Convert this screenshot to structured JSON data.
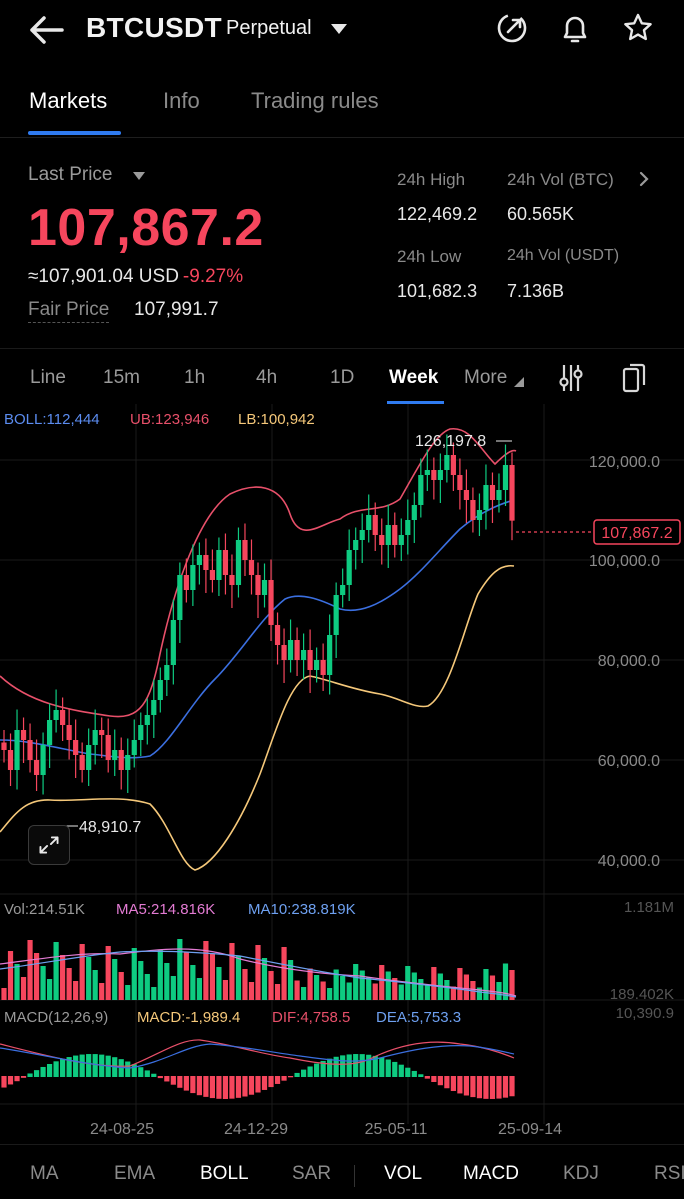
{
  "header": {
    "symbol": "BTCUSDT",
    "contract_type": "Perpetual",
    "icons": [
      "back-arrow-icon",
      "dropdown-caret-icon",
      "share-icon",
      "bell-icon",
      "star-icon"
    ]
  },
  "tabs": [
    {
      "label": "Markets",
      "active": true
    },
    {
      "label": "Info",
      "active": false
    },
    {
      "label": "Trading rules",
      "active": false
    }
  ],
  "price": {
    "last_price_label": "Last Price",
    "last_price": "107,867.2",
    "usd_equiv": "≈107,901.04 USD",
    "change_pct": "-9.27%",
    "fair_price_label": "Fair Price",
    "fair_price": "107,991.7"
  },
  "stats": {
    "high_label": "24h High",
    "high": "122,469.2",
    "low_label": "24h Low",
    "low": "101,682.3",
    "vol_btc_label": "24h Vol (BTC)",
    "vol_btc": "60.565K",
    "vol_usdt_label": "24h Vol  (USDT)",
    "vol_usdt": "7.136B"
  },
  "intervals": [
    "Line",
    "15m",
    "1h",
    "4h",
    "1D",
    "Week",
    "More"
  ],
  "active_interval": "Week",
  "boll_legend": {
    "boll": "BOLL:112,444",
    "ub": "UB:123,946",
    "lb": "LB:100,942"
  },
  "price_axis": {
    "ticks": [
      "120,000.0",
      "100,000.0",
      "80,000.0",
      "60,000.0",
      "40,000.0"
    ],
    "current_tag": "107,867.2",
    "max_label": "126,197.8",
    "min_label": "48,910.7"
  },
  "vol_legend": {
    "vol": "Vol:214.51K",
    "ma5": "MA5:214.816K",
    "ma10": "MA10:238.819K",
    "axis_max": "1.181M",
    "axis_min": "189.402K"
  },
  "macd_legend": {
    "macd_params": "MACD(12,26,9)",
    "macd": "MACD:-1,989.4",
    "dif": "DIF:4,758.5",
    "dea": "DEA:5,753.3",
    "axis_max": "10,390.9"
  },
  "date_axis": [
    "24-08-25",
    "24-12-29",
    "25-05-11",
    "25-09-14"
  ],
  "indicators": [
    {
      "label": "MA",
      "active": false
    },
    {
      "label": "EMA",
      "active": false
    },
    {
      "label": "BOLL",
      "active": true
    },
    {
      "label": "SAR",
      "active": false
    },
    {
      "label": "VOL",
      "active": true
    },
    {
      "label": "MACD",
      "active": true
    },
    {
      "label": "KDJ",
      "active": false
    },
    {
      "label": "RSI",
      "active": false
    }
  ],
  "colors": {
    "up": "#0ecb81",
    "down": "#f6465d",
    "accent": "#2f7bf0",
    "boll_mid": "#3b6fe0",
    "boll_upper": "#e8506a",
    "boll_lower": "#f5c87a",
    "ma5": "#e37bd3",
    "ma10": "#6ea0f0"
  },
  "chart_data": {
    "type": "candlestick",
    "title": "",
    "x_labels": [
      "24-08-25",
      "24-12-29",
      "25-05-11",
      "25-09-14"
    ],
    "ylim": [
      40000,
      130000
    ],
    "y_ticks": [
      120000,
      100000,
      80000,
      60000,
      40000
    ],
    "series_close": [
      62000,
      58000,
      66000,
      64000,
      60000,
      57000,
      63000,
      68000,
      70000,
      67000,
      64000,
      61000,
      58000,
      63000,
      66000,
      65000,
      60000,
      62000,
      58000,
      61000,
      64000,
      67000,
      69000,
      72000,
      76000,
      79000,
      88000,
      97000,
      94000,
      99000,
      101000,
      98000,
      96000,
      102000,
      97000,
      95000,
      104000,
      100000,
      97000,
      93000,
      96000,
      87000,
      83000,
      80000,
      84000,
      80000,
      82000,
      78000,
      80000,
      77000,
      85000,
      93000,
      95000,
      102000,
      104000,
      106000,
      109000,
      105000,
      103000,
      107000,
      103000,
      105000,
      108000,
      111000,
      117000,
      118000,
      116000,
      118000,
      121000,
      117000,
      114000,
      112000,
      108000,
      110000,
      115000,
      112000,
      114000,
      119000,
      107867
    ],
    "last": 107867.2,
    "max": 126197.8,
    "min": 48910.7
  }
}
